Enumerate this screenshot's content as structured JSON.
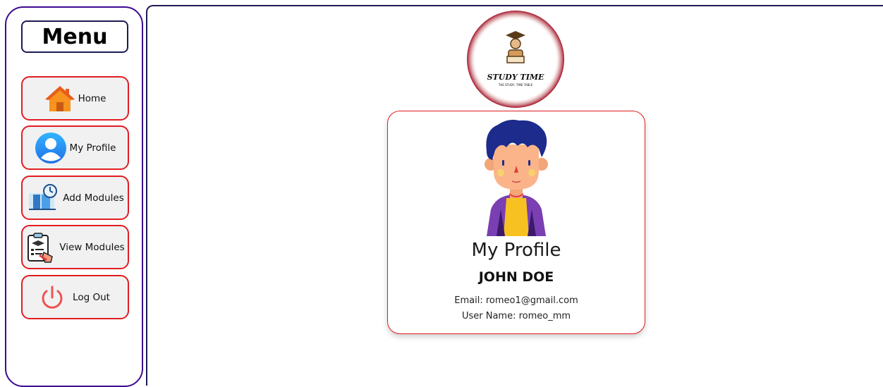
{
  "sidebar": {
    "title": "Menu",
    "items": [
      {
        "label": "Home",
        "icon": "home-icon"
      },
      {
        "label": "My Profile",
        "icon": "user-icon"
      },
      {
        "label": "Add Modules",
        "icon": "add-modules-icon"
      },
      {
        "label": "View Modules",
        "icon": "view-modules-icon"
      },
      {
        "label": "Log Out",
        "icon": "power-icon"
      }
    ]
  },
  "logo": {
    "text": "STUDY TIME",
    "tagline": "THE STUDY, TIME TABLE"
  },
  "profile": {
    "heading": "My Profile",
    "name": "JOHN DOE",
    "email_line": "Email: romeo1@gmail.com",
    "username_line": "User Name: romeo_mm"
  },
  "colors": {
    "sidebar_border": "#3d0a91",
    "button_border": "#e11d22",
    "button_bg": "#f1f1f1",
    "card_border": "#e11d22"
  }
}
